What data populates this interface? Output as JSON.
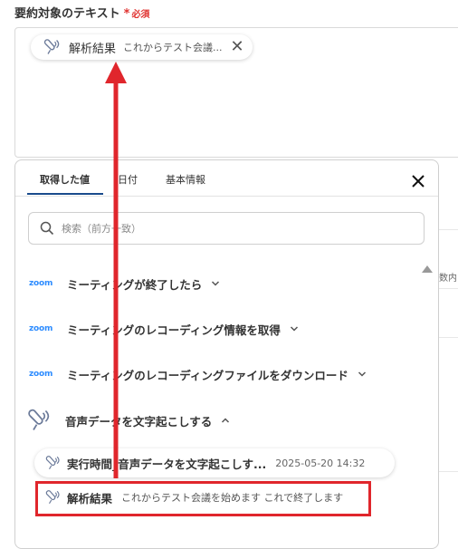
{
  "field": {
    "label": "要約対象のテキスト",
    "required_star": "*",
    "required_text": "必須"
  },
  "chip": {
    "icon": "microphone-wave-icon",
    "label": "解析結果",
    "value": "これからテスト会議...",
    "close_icon": "close-icon"
  },
  "background": {
    "partial_text": "数内"
  },
  "panel": {
    "tabs": [
      {
        "label": "取得した値",
        "active": true
      },
      {
        "label": "日付",
        "active": false
      },
      {
        "label": "基本情報",
        "active": false
      }
    ],
    "close_icon": "close-icon",
    "search": {
      "icon": "search-icon",
      "placeholder": "検索（前方一致）"
    },
    "groups": [
      {
        "logo": "zoom",
        "label": "ミーティングが終了したら",
        "expanded": false
      },
      {
        "logo": "zoom",
        "label": "ミーティングのレコーディング情報を取得",
        "expanded": false
      },
      {
        "logo": "zoom",
        "label": "ミーティングのレコーディングファイルをダウンロード",
        "expanded": false
      },
      {
        "logo": "microphone-wave-icon",
        "label": "音声データを文字起こしする",
        "expanded": true
      }
    ],
    "sub_items": [
      {
        "label": "実行時間_音声データを文字起こしす...",
        "value": "2025-05-20 14:32"
      },
      {
        "label": "解析結果",
        "value": "これからテスト会議を始めます これで終了します"
      }
    ]
  },
  "annotation": {
    "color": "#e0262c"
  }
}
